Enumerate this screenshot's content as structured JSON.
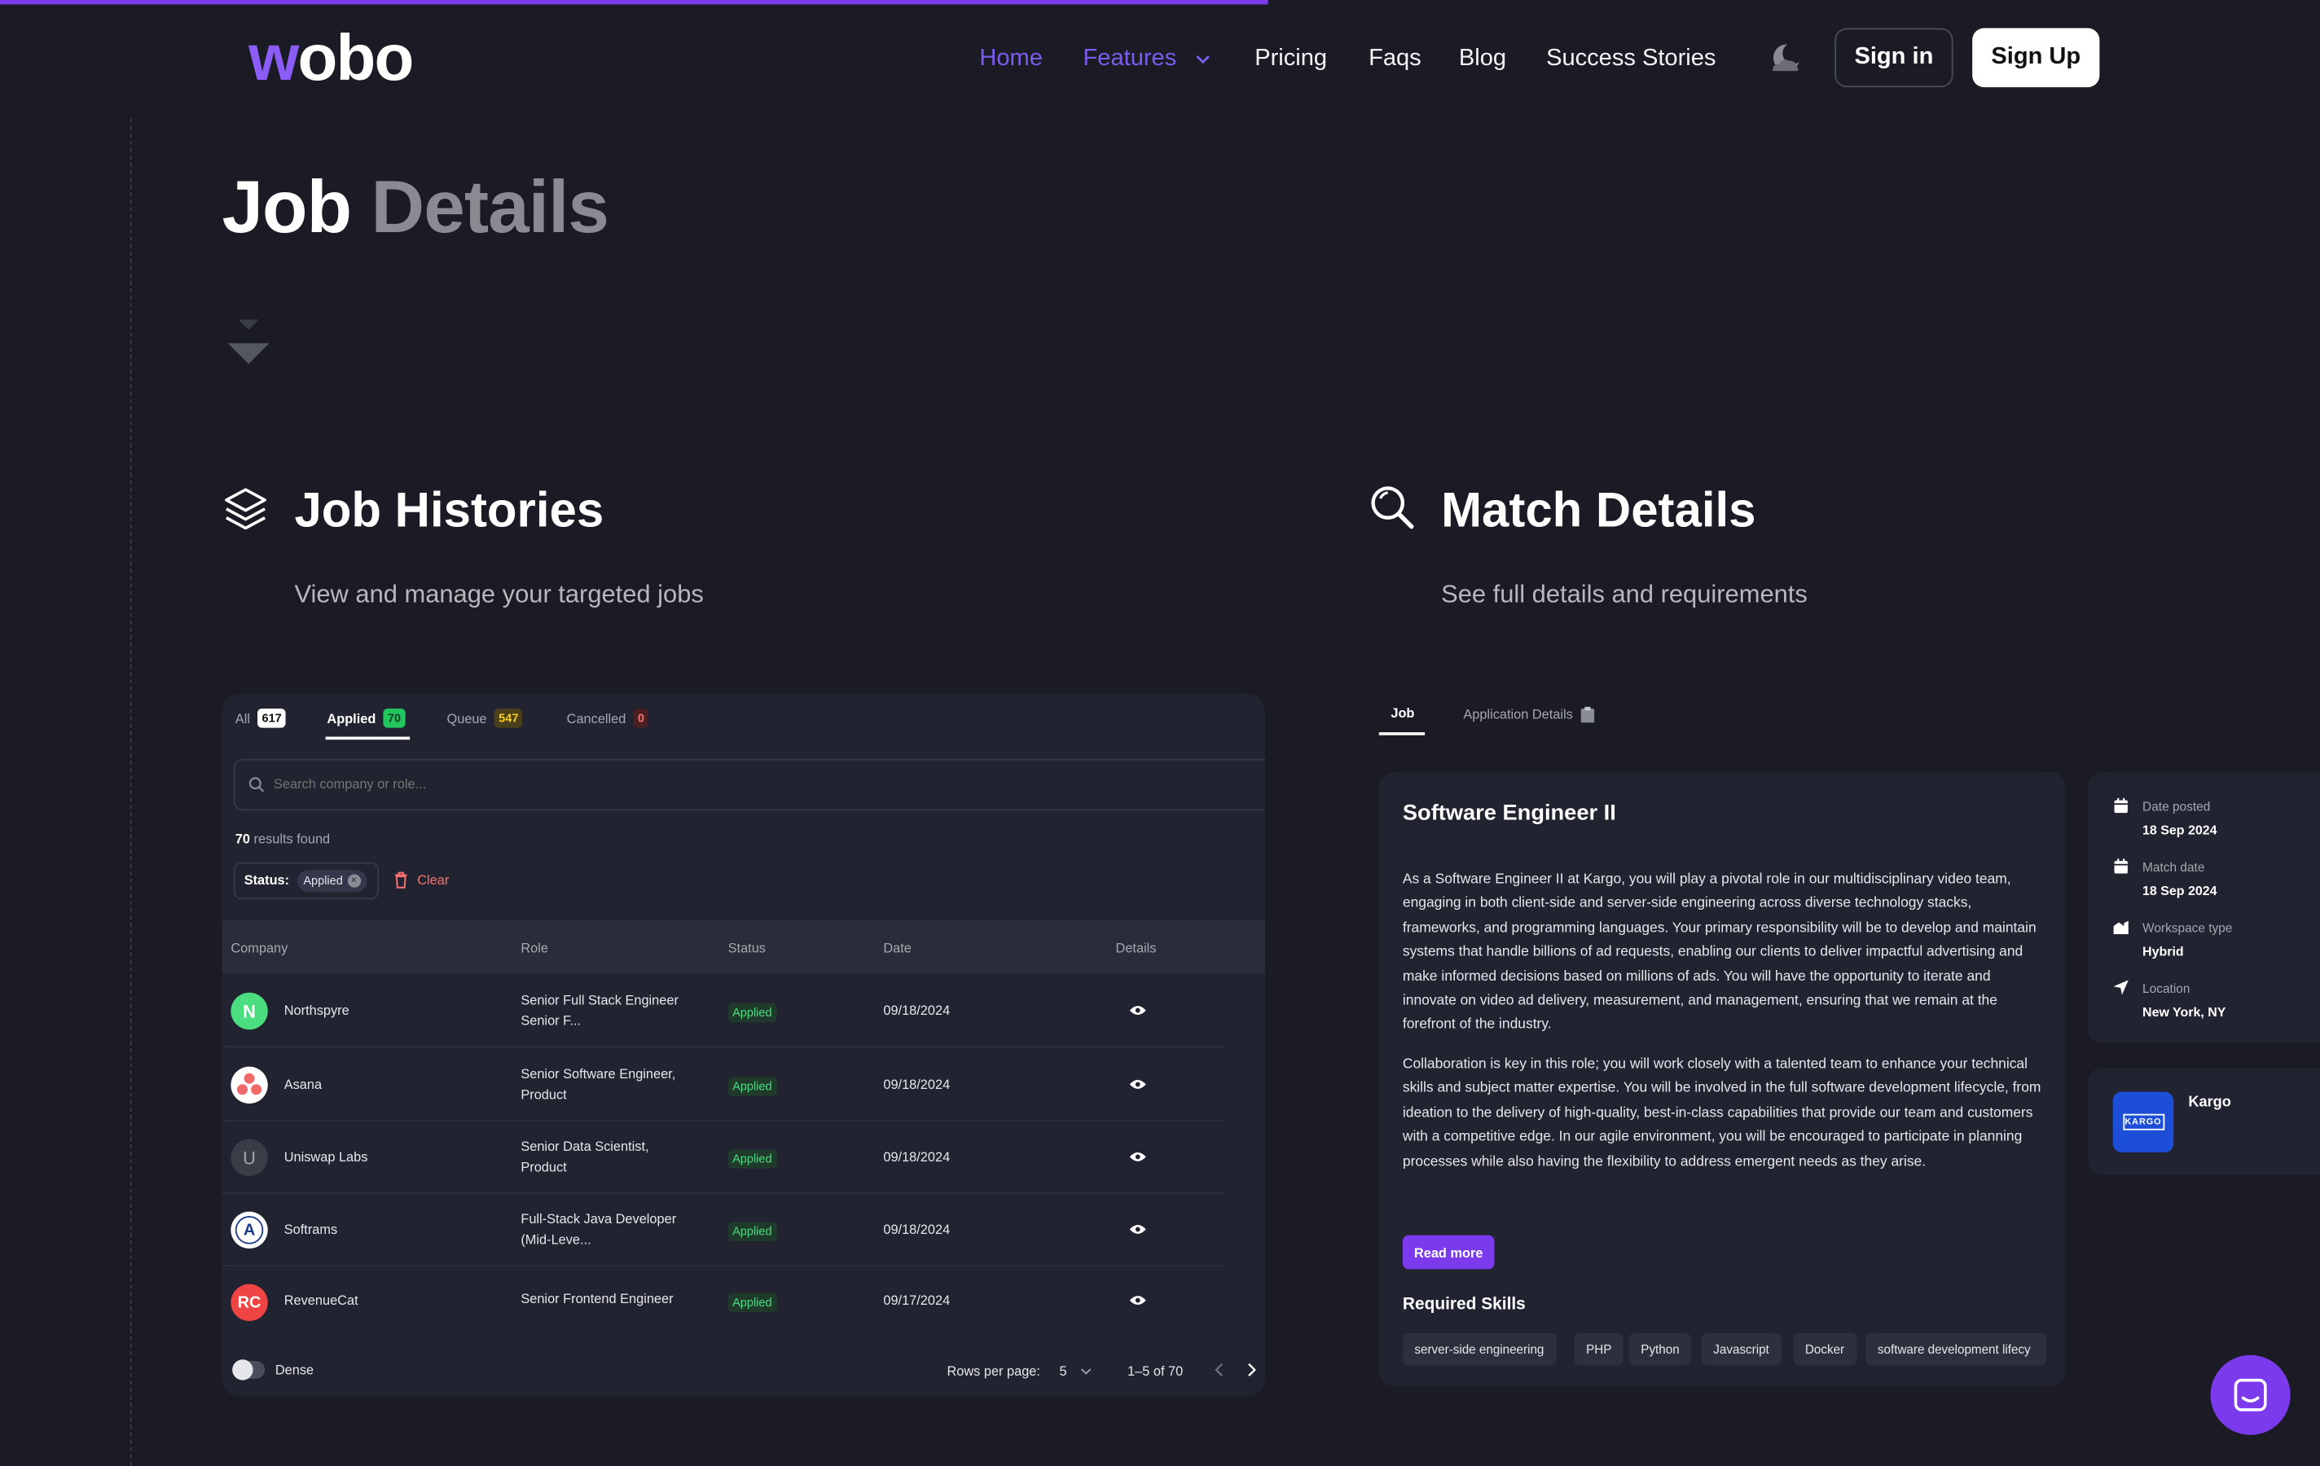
{
  "header": {
    "logo": {
      "w": "w",
      "rest": "obo"
    },
    "nav": [
      {
        "label": "Home"
      },
      {
        "label": "Features"
      },
      {
        "label": "Pricing"
      },
      {
        "label": "Faqs"
      },
      {
        "label": "Blog"
      },
      {
        "label": "Success Stories"
      }
    ],
    "sign_in": "Sign in",
    "sign_up": "Sign Up",
    "accent": "#7c3aed"
  },
  "hero": {
    "title_1": "Job",
    "title_2": "Details"
  },
  "sections": {
    "histories": {
      "title": "Job Histories",
      "subtitle": "View and manage your targeted jobs"
    },
    "match": {
      "title": "Match Details",
      "subtitle": "See full details and requirements"
    }
  },
  "histories": {
    "tabs": [
      {
        "label": "All",
        "count": "617"
      },
      {
        "label": "Applied",
        "count": "70"
      },
      {
        "label": "Queue",
        "count": "547"
      },
      {
        "label": "Cancelled",
        "count": "0"
      }
    ],
    "search": {
      "placeholder": "Search company or role..."
    },
    "results": {
      "count": "70",
      "text": "results found"
    },
    "filter": {
      "label": "Status:",
      "value": "Applied",
      "clear": "Clear"
    },
    "columns": [
      "Company",
      "Role",
      "Status",
      "Date",
      "Details"
    ],
    "rows": [
      {
        "avatar": "N",
        "company": "Northspyre",
        "role_1": "Senior Full Stack Engineer",
        "role_2": "Senior F...",
        "status": "Applied",
        "date": "09/18/2024"
      },
      {
        "avatar": "",
        "company": "Asana",
        "role_1": "Senior Software Engineer,",
        "role_2": "Product",
        "status": "Applied",
        "date": "09/18/2024"
      },
      {
        "avatar": "U",
        "company": "Uniswap Labs",
        "role_1": "Senior Data Scientist,",
        "role_2": "Product",
        "status": "Applied",
        "date": "09/18/2024"
      },
      {
        "avatar": "A",
        "company": "Softrams",
        "role_1": "Full-Stack Java Developer",
        "role_2": "(Mid-Leve...",
        "status": "Applied",
        "date": "09/18/2024"
      },
      {
        "avatar": "RC",
        "company": "RevenueCat",
        "role_1": "Senior Frontend Engineer",
        "role_2": "",
        "status": "Applied",
        "date": "09/17/2024"
      }
    ],
    "footer": {
      "dense": "Dense",
      "rows_per_page": "Rows per page:",
      "rows_value": "5",
      "range": "1–5 of 70"
    }
  },
  "match": {
    "tabs": [
      {
        "label": "Job"
      },
      {
        "label": "Application Details"
      }
    ],
    "job_title": "Software Engineer II",
    "description_1": "As a Software Engineer II at Kargo, you will play a pivotal role in our multidisciplinary video team, engaging in both client-side and server-side engineering across diverse technology stacks, frameworks, and programming languages. Your primary responsibility will be to develop and maintain systems that handle billions of ad requests, enabling our clients to deliver impactful advertising and make informed decisions based on millions of ads. You will have the opportunity to iterate and innovate on video ad delivery, measurement, and management, ensuring that we remain at the forefront of the industry.",
    "description_2": "Collaboration is key in this role; you will work closely with a talented team to enhance your technical skills and subject matter expertise. You will be involved in the full software development lifecycle, from ideation to the delivery of high-quality, best-in-class capabilities that provide our team and customers with a competitive edge. In our agile environment, you will be encouraged to participate in planning processes while also having the flexibility to address emergent needs as they arise.",
    "read_more": "Read more",
    "skills_title": "Required Skills",
    "skills": [
      "server-side engineering",
      "PHP",
      "Python",
      "Javascript",
      "Docker",
      "software development lifecy"
    ],
    "info": [
      {
        "label": "Date posted",
        "value": "18 Sep 2024"
      },
      {
        "label": "Match date",
        "value": "18 Sep 2024"
      },
      {
        "label": "Workspace type",
        "value": "Hybrid"
      },
      {
        "label": "Location",
        "value": "New York, NY"
      }
    ],
    "company": {
      "name": "Kargo",
      "logo_text": "KARGO"
    }
  }
}
